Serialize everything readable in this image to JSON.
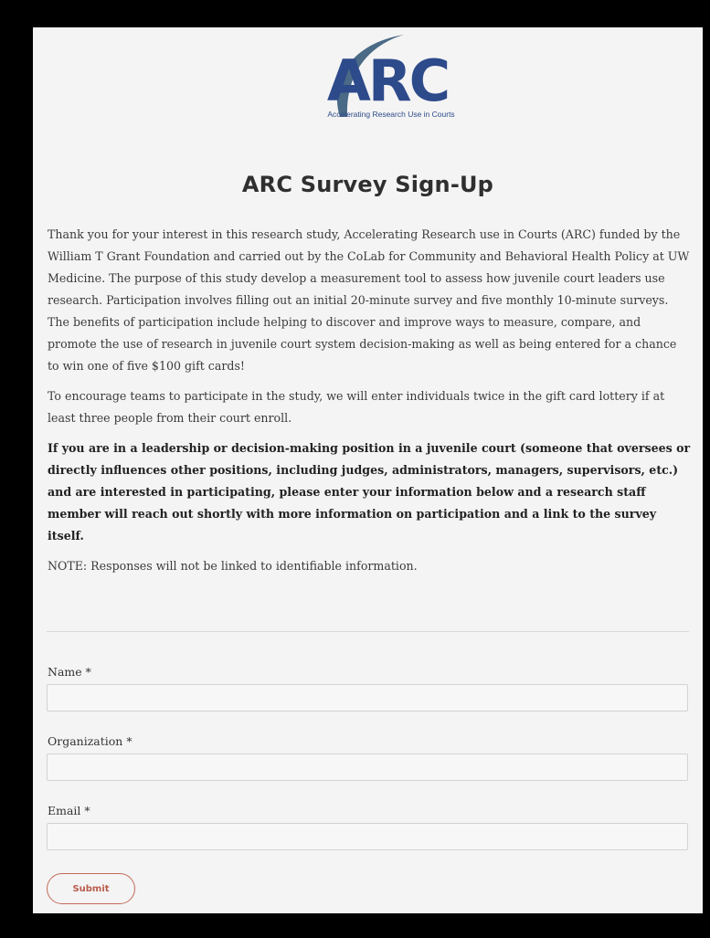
{
  "logo": {
    "name": "ARC",
    "tagline": "Accelerating Research Use in Courts",
    "color": "#2d4a8a",
    "swoosh_color": "#4a6a86"
  },
  "page": {
    "title": "ARC Survey Sign-Up",
    "paragraphs": [
      "Thank you for your interest in this research study, Accelerating Research use in Courts (ARC) funded by the William T Grant Foundation and carried out by the CoLab for Community and Behavioral Health Policy at UW Medicine. The purpose of this study develop a measurement tool to assess how juvenile court leaders use research. Participation involves filling out an initial 20-minute survey and five monthly 10-minute surveys. The benefits of participation include helping to discover and improve ways to measure, compare, and promote the use of research in juvenile court system decision-making as well as being entered for a chance to win one of five $100 gift cards!",
      "To encourage teams to participate in the study, we will enter individuals twice in the gift card lottery if at least three people from their court enroll.",
      "If you are in a leadership or decision-making position in a juvenile court (someone that oversees or directly influences other positions, including judges, administrators, managers, supervisors, etc.) and are interested in participating, please enter your information below and a research staff member will reach out shortly with more information on participation and a link to the survey itself.",
      "NOTE: Responses will not be linked to identifiable information."
    ]
  },
  "form": {
    "name_label": "Name *",
    "name_value": "",
    "organization_label": "Organization *",
    "organization_value": "",
    "email_label": "Email *",
    "email_value": "",
    "submit_label": "Submit",
    "accent_color": "#b95c4c"
  }
}
